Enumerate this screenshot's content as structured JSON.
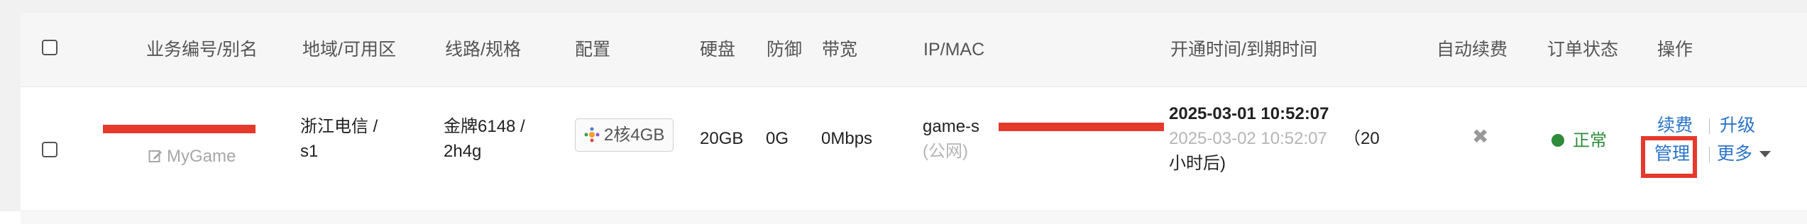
{
  "header": {
    "id_alias": "业务编号/别名",
    "region": "地域/可用区",
    "line_spec": "线路/规格",
    "config": "配置",
    "disk": "硬盘",
    "defense": "防御",
    "bandwidth": "带宽",
    "ip_mac": "IP/MAC",
    "time": "开通时间/到期时间",
    "auto_renew": "自动续费",
    "order_status": "订单状态",
    "actions": "操作"
  },
  "row": {
    "alias": "MyGame",
    "region_line1": "浙江电信 /",
    "region_line2": "s1",
    "line_line1": "金牌6148 /",
    "line_line2": "2h4g",
    "config_badge": "2核4GB",
    "disk": "20GB",
    "defense": "0G",
    "bandwidth": "0Mbps",
    "ip_line1": "game-s",
    "ip_line2": "(公网)",
    "open_time": "2025-03-01 10:52:07",
    "expire_time": "2025-03-02 10:52:07",
    "remaining_a": "（20",
    "remaining_b": "小时后)",
    "auto_renew_icon": "x-icon",
    "status": "正常",
    "status_color": "#2e8b3a",
    "renew": "续费",
    "upgrade": "升级",
    "manage": "管理",
    "more": "更多"
  },
  "colors": {
    "link": "#2a74c7",
    "highlight": "#e5392c"
  }
}
